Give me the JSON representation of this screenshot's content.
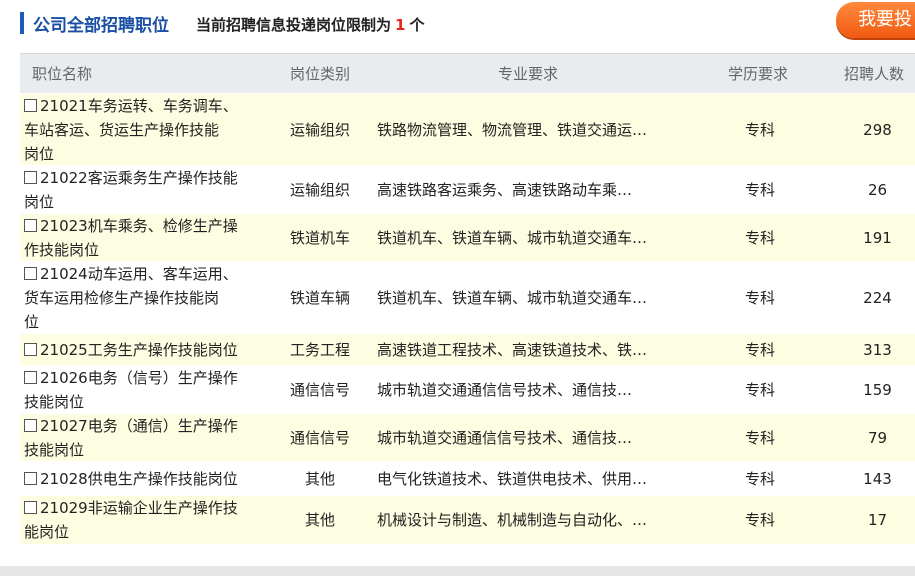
{
  "header": {
    "title": "公司全部招聘职位",
    "notice_prefix": "当前招聘信息投递岗位限制为",
    "notice_num": "1",
    "notice_suffix": "个",
    "apply_button": "我要投"
  },
  "columns": {
    "name": "职位名称",
    "category": "岗位类别",
    "major": "专业要求",
    "education": "学历要求",
    "count": "招聘人数"
  },
  "rows": [
    {
      "name_lines": [
        "21021车务运转、车务调车、",
        "车站客运、货运生产操作技能",
        "岗位"
      ],
      "category": "运输组织",
      "major": "铁路物流管理、物流管理、铁道交通运…",
      "education": "专科",
      "count": "298"
    },
    {
      "name_lines": [
        "21022客运乘务生产操作技能",
        "岗位"
      ],
      "category": "运输组织",
      "major": "高速铁路客运乘务、高速铁路动车乘…",
      "education": "专科",
      "count": "26"
    },
    {
      "name_lines": [
        "21023机车乘务、检修生产操",
        "作技能岗位"
      ],
      "category": "铁道机车",
      "major": "铁道机车、铁道车辆、城市轨道交通车…",
      "education": "专科",
      "count": "191"
    },
    {
      "name_lines": [
        "21024动车运用、客车运用、",
        "货车运用检修生产操作技能岗",
        "位"
      ],
      "category": "铁道车辆",
      "major": "铁道机车、铁道车辆、城市轨道交通车…",
      "education": "专科",
      "count": "224"
    },
    {
      "name_lines": [
        "21025工务生产操作技能岗位"
      ],
      "category": "工务工程",
      "major": "高速铁道工程技术、高速铁道技术、铁…",
      "education": "专科",
      "count": "313"
    },
    {
      "name_lines": [
        "21026电务（信号）生产操作",
        "技能岗位"
      ],
      "category": "通信信号",
      "major": "城市轨道交通通信信号技术、通信技…",
      "education": "专科",
      "count": "159"
    },
    {
      "name_lines": [
        "21027电务（通信）生产操作",
        "技能岗位"
      ],
      "category": "通信信号",
      "major": "城市轨道交通通信信号技术、通信技…",
      "education": "专科",
      "count": "79"
    },
    {
      "name_lines": [
        "21028供电生产操作技能岗位"
      ],
      "category": "其他",
      "major": "电气化铁道技术、铁道供电技术、供用…",
      "education": "专科",
      "count": "143"
    },
    {
      "name_lines": [
        "21029非运输企业生产操作技",
        "能岗位"
      ],
      "category": "其他",
      "major": "机械设计与制造、机械制造与自动化、…",
      "education": "专科",
      "count": "17"
    }
  ]
}
